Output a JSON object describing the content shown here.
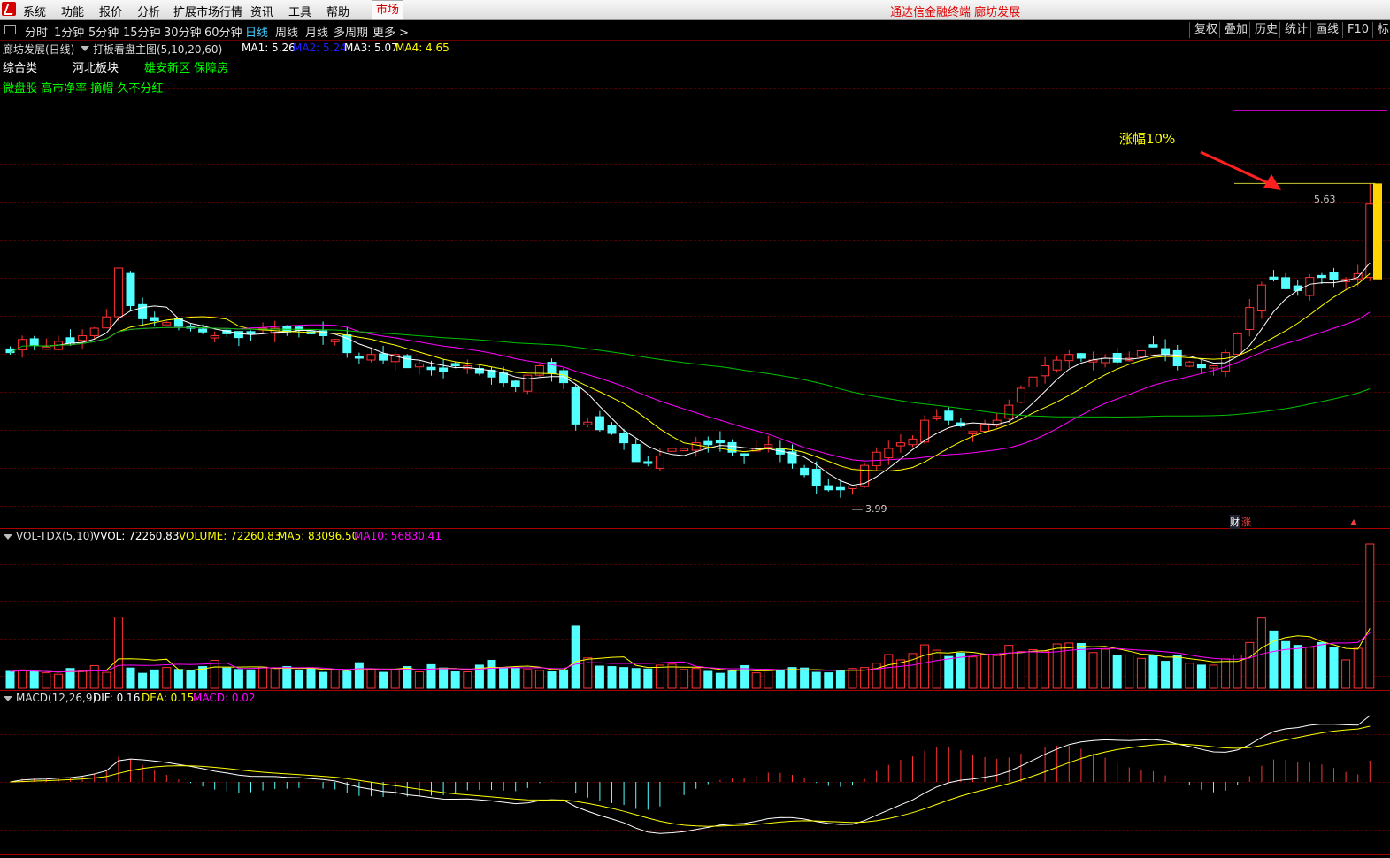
{
  "menu": {
    "items": [
      "系统",
      "功能",
      "报价",
      "分析",
      "扩展市场行情",
      "资讯",
      "工具",
      "帮助"
    ],
    "market": "市场",
    "app_title": "通达信金融终端  廊坊发展"
  },
  "periods": {
    "tabs": [
      "分时",
      "1分钟",
      "5分钟",
      "15分钟",
      "30分钟",
      "60分钟",
      "日线",
      "周线",
      "月线",
      "多周期",
      "更多 >"
    ],
    "active": "日线",
    "tools": [
      "复权",
      "叠加",
      "历史",
      "统计",
      "画线",
      "F10",
      "标"
    ]
  },
  "main": {
    "stock": "廊坊发展(日线)",
    "indicator": "打板看盘主图(5,10,20,60)",
    "ma1": "MA1: 5.26",
    "ma2": "MA2: 5.24",
    "ma3": "MA3: 5.07",
    "ma4": "MA4: 4.65",
    "tags": [
      "综合类",
      "河北板块",
      "雄安新区 保障房",
      "微盘股 高市净率 摘帽 久不分红"
    ],
    "annotation": "涨幅10%",
    "high_label": "5.63",
    "low_label": "3.99",
    "badges": [
      "财",
      "涨"
    ]
  },
  "volume": {
    "name": "VOL-TDX(5,10)",
    "vvol": "VVOL: 72260.83",
    "volume": "VOLUME: 72260.83",
    "ma5": "MA5: 83096.50",
    "ma10": "MA10: 56830.41"
  },
  "macd": {
    "name": "MACD(12,26,9)",
    "dif": "DIF: 0.16",
    "dea": "DEA: 0.15",
    "macd": "MACD: 0.02"
  },
  "colors": {
    "up": "#ff3232",
    "down": "#54ffff",
    "ma1": "#ffffff",
    "ma2": "#ffff00",
    "ma3": "#ff00ff",
    "ma4": "#00c000",
    "text_yellow": "#ffff00",
    "text_green": "#00ff00"
  },
  "chart_data": {
    "type": "candlestick",
    "price_range": [
      3.9,
      5.9
    ],
    "closes": [
      4.73,
      4.8,
      4.77,
      4.76,
      4.79,
      4.78,
      4.82,
      4.86,
      4.92,
      5.18,
      4.98,
      4.91,
      4.9,
      4.89,
      4.87,
      4.86,
      4.84,
      4.82,
      4.83,
      4.81,
      4.83,
      4.86,
      4.86,
      4.84,
      4.85,
      4.83,
      4.82,
      4.8,
      4.73,
      4.7,
      4.72,
      4.69,
      4.72,
      4.65,
      4.67,
      4.64,
      4.63,
      4.66,
      4.66,
      4.62,
      4.6,
      4.57,
      4.55,
      4.61,
      4.66,
      4.62,
      4.57,
      4.35,
      4.36,
      4.32,
      4.3,
      4.25,
      4.15,
      4.14,
      4.18,
      4.22,
      4.22,
      4.25,
      4.24,
      4.25,
      4.2,
      4.18,
      4.22,
      4.24,
      4.19,
      4.14,
      4.08,
      4.02,
      4.0,
      4.0,
      4.02,
      4.13,
      4.2,
      4.22,
      4.25,
      4.27,
      4.37,
      4.39,
      4.37,
      4.34,
      4.31,
      4.35,
      4.37,
      4.45,
      4.54,
      4.6,
      4.66,
      4.69,
      4.72,
      4.7,
      4.69,
      4.7,
      4.68,
      4.7,
      4.74,
      4.76,
      4.72,
      4.66,
      4.68,
      4.65,
      4.66,
      4.73,
      4.83,
      4.97,
      5.09,
      5.12,
      5.07,
      5.06,
      5.13,
      5.13,
      5.12,
      5.12,
      5.15,
      5.52
    ],
    "volumes": [
      3.5,
      3.8,
      3.4,
      3.2,
      2.9,
      4.1,
      3.6,
      4.7,
      3.3,
      14.8,
      4.2,
      3.1,
      3.8,
      4.3,
      3.9,
      3.6,
      4.5,
      5.8,
      4.2,
      3.9,
      3.8,
      4.4,
      4.2,
      4.5,
      3.6,
      4.1,
      3.3,
      3.8,
      3.5,
      5.3,
      4.0,
      3.3,
      3.8,
      4.5,
      3.4,
      4.9,
      4.2,
      3.4,
      3.4,
      4.8,
      5.8,
      4.3,
      4.2,
      3.9,
      3.7,
      3.4,
      3.8,
      12.9,
      6.3,
      4.6,
      4.5,
      4.3,
      4.1,
      4.0,
      4.8,
      5.0,
      3.9,
      4.1,
      3.5,
      3.1,
      3.5,
      4.7,
      3.2,
      3.7,
      3.8,
      4.3,
      4.2,
      3.3,
      3.2,
      3.7,
      4.1,
      4.3,
      5.2,
      7.0,
      5.9,
      7.2,
      9.0,
      7.9,
      6.6,
      7.3,
      6.5,
      7.1,
      6.8,
      8.9,
      7.6,
      8.0,
      7.7,
      9.2,
      9.4,
      9.3,
      7.4,
      8.1,
      6.8,
      6.9,
      6.2,
      6.8,
      5.6,
      6.9,
      5.2,
      4.8,
      4.8,
      6.1,
      6.9,
      9.5,
      14.6,
      11.9,
      9.7,
      8.9,
      8.5,
      9.5,
      8.5,
      5.9,
      8.3,
      30.0
    ]
  }
}
